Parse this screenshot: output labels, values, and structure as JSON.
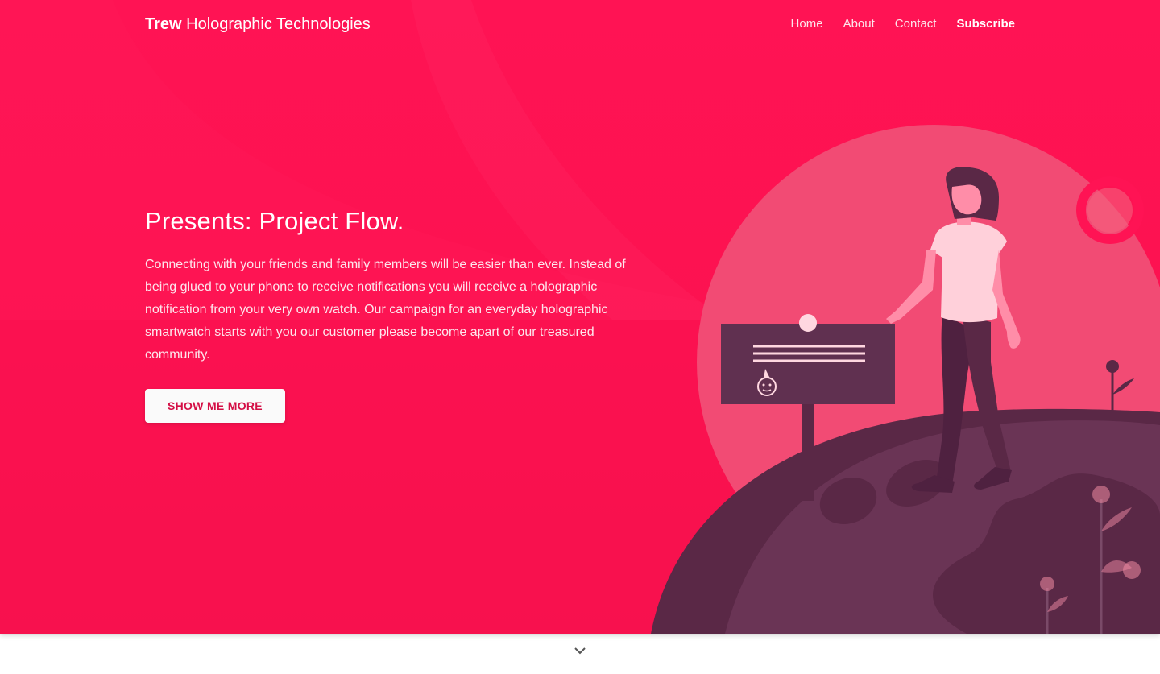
{
  "nav": {
    "brand_strong": "Trew",
    "brand_rest": " Holographic Technologies",
    "links": [
      {
        "label": "Home"
      },
      {
        "label": "About"
      },
      {
        "label": "Contact"
      },
      {
        "label": "Subscribe"
      }
    ]
  },
  "hero": {
    "headline": "Presents: Project Flow.",
    "lead": "Connecting with your friends and family members will be easier than ever. Instead of being glued to your phone to receive notifications you will receive a holographic notification from your very own watch. Our campaign for an everyday holographic smartwatch starts with you our customer please become apart of our treasured community.",
    "cta_label": "SHOW ME MORE"
  },
  "theme": {
    "primary": "#ff1354",
    "planet": "#5a2846",
    "circle": "#f24b74",
    "button_text": "#d40e45"
  },
  "icons": {
    "scroll": "chevron-down-icon"
  }
}
